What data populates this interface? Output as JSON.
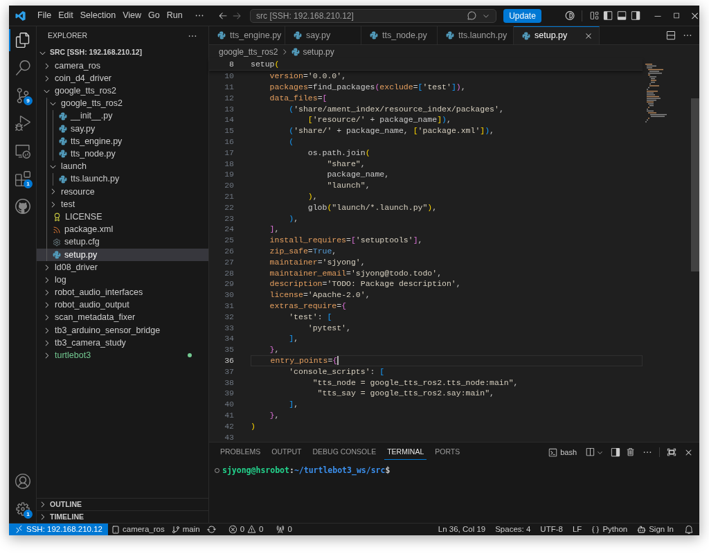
{
  "title_bar": {
    "menu": [
      "File",
      "Edit",
      "Selection",
      "View",
      "Go",
      "Run"
    ],
    "search": {
      "value": "src [SSH: 192.168.210.12]"
    },
    "update_button": "Update"
  },
  "activity_bar": {
    "top": [
      {
        "kind": "explorer",
        "selected": true
      },
      {
        "kind": "search",
        "selected": false
      },
      {
        "kind": "source_control",
        "selected": false,
        "badge": "9"
      },
      {
        "kind": "run",
        "selected": false
      },
      {
        "kind": "remote",
        "selected": false
      },
      {
        "kind": "extensions",
        "selected": false,
        "badge": "1"
      },
      {
        "kind": "github",
        "selected": false
      }
    ],
    "bottom": [
      {
        "kind": "accounts"
      },
      {
        "kind": "settings",
        "badge": "1"
      }
    ]
  },
  "sidebar": {
    "title": "EXPLORER",
    "root": "SRC [SSH: 192.168.210.12]",
    "items": [
      {
        "name": "camera_ros",
        "kind": "folder",
        "expanded": false,
        "selected": false,
        "modified": false
      },
      {
        "name": "coin_d4_driver",
        "kind": "folder",
        "expanded": false,
        "selected": false,
        "modified": false
      },
      {
        "name": "google_tts_ros2",
        "kind": "folder",
        "expanded": true,
        "selected": false,
        "modified": false,
        "children": [
          {
            "name": "google_tts_ros2",
            "kind": "folder",
            "expanded": true,
            "selected": false,
            "modified": false,
            "children": [
              {
                "name": "__init__.py",
                "kind": "python",
                "selected": false,
                "modified": false
              },
              {
                "name": "say.py",
                "kind": "python",
                "selected": false,
                "modified": false
              },
              {
                "name": "tts_engine.py",
                "kind": "python",
                "selected": false,
                "modified": false
              },
              {
                "name": "tts_node.py",
                "kind": "python",
                "selected": false,
                "modified": false
              }
            ]
          },
          {
            "name": "launch",
            "kind": "folder",
            "expanded": true,
            "selected": false,
            "modified": false,
            "children": [
              {
                "name": "tts.launch.py",
                "kind": "python",
                "selected": false,
                "modified": false
              }
            ]
          },
          {
            "name": "resource",
            "kind": "folder",
            "expanded": false,
            "selected": false,
            "modified": false
          },
          {
            "name": "test",
            "kind": "folder",
            "expanded": false,
            "selected": false,
            "modified": false
          },
          {
            "name": "LICENSE",
            "kind": "license",
            "selected": false,
            "modified": false
          },
          {
            "name": "package.xml",
            "kind": "xml",
            "selected": false,
            "modified": false
          },
          {
            "name": "setup.cfg",
            "kind": "config",
            "selected": false,
            "modified": false
          },
          {
            "name": "setup.py",
            "kind": "python",
            "selected": true,
            "modified": false
          }
        ]
      },
      {
        "name": "ld08_driver",
        "kind": "folder",
        "expanded": false,
        "selected": false,
        "modified": false
      },
      {
        "name": "log",
        "kind": "folder",
        "expanded": false,
        "selected": false,
        "modified": false
      },
      {
        "name": "robot_audio_interfaces",
        "kind": "folder",
        "expanded": false,
        "selected": false,
        "modified": false
      },
      {
        "name": "robot_audio_output",
        "kind": "folder",
        "expanded": false,
        "selected": false,
        "modified": false
      },
      {
        "name": "scan_metadata_fixer",
        "kind": "folder",
        "expanded": false,
        "selected": false,
        "modified": false
      },
      {
        "name": "tb3_arduino_sensor_bridge",
        "kind": "folder",
        "expanded": false,
        "selected": false,
        "modified": false
      },
      {
        "name": "tb3_camera_study",
        "kind": "folder",
        "expanded": false,
        "selected": false,
        "modified": false
      },
      {
        "name": "turtlebot3",
        "kind": "folder",
        "expanded": false,
        "selected": false,
        "modified": true
      }
    ],
    "sections": [
      {
        "label": "OUTLINE",
        "expanded": false
      },
      {
        "label": "TIMELINE",
        "expanded": false
      }
    ]
  },
  "tabs": [
    {
      "label": "tts_engine.py",
      "selected": false
    },
    {
      "label": "say.py",
      "selected": false
    },
    {
      "label": "tts_node.py",
      "selected": false
    },
    {
      "label": "tts.launch.py",
      "selected": false
    },
    {
      "label": "setup.py",
      "selected": true
    }
  ],
  "breadcrumb": [
    "google_tts_ros2",
    "setup.py"
  ],
  "sticky_line": {
    "number": "8",
    "tokens": [
      {
        "text": "setup",
        "kind": "plain"
      },
      {
        "text": "(",
        "kind": "gold"
      }
    ]
  },
  "code_lines": [
    {
      "number": "10",
      "current": false,
      "tokens": [
        {
          "text": "    version",
          "kind": "param"
        },
        {
          "text": "=",
          "kind": "plain"
        },
        {
          "text": "'0.0.0'",
          "kind": "string"
        },
        {
          "text": ",",
          "kind": "plain"
        }
      ]
    },
    {
      "number": "11",
      "current": false,
      "tokens": [
        {
          "text": "    packages",
          "kind": "param"
        },
        {
          "text": "=find_packages",
          "kind": "plain"
        },
        {
          "text": "(",
          "kind": "pink"
        },
        {
          "text": "exclude",
          "kind": "param"
        },
        {
          "text": "=",
          "kind": "plain"
        },
        {
          "text": "[",
          "kind": "blue"
        },
        {
          "text": "'test'",
          "kind": "string"
        },
        {
          "text": "]",
          "kind": "blue"
        },
        {
          "text": ")",
          "kind": "pink"
        },
        {
          "text": ",",
          "kind": "plain"
        }
      ]
    },
    {
      "number": "12",
      "current": false,
      "tokens": [
        {
          "text": "    data_files",
          "kind": "param"
        },
        {
          "text": "=",
          "kind": "plain"
        },
        {
          "text": "[",
          "kind": "pink"
        }
      ]
    },
    {
      "number": "13",
      "current": false,
      "tokens": [
        {
          "text": "        (",
          "kind": "blue"
        },
        {
          "text": "'share/ament_index/resource_index/packages'",
          "kind": "string"
        },
        {
          "text": ",",
          "kind": "plain"
        }
      ]
    },
    {
      "number": "14",
      "current": false,
      "tokens": [
        {
          "text": "            [",
          "kind": "gold"
        },
        {
          "text": "'resource/'",
          "kind": "string"
        },
        {
          "text": " + package_name",
          "kind": "plain"
        },
        {
          "text": "]",
          "kind": "gold"
        },
        {
          "text": ")",
          "kind": "blue"
        },
        {
          "text": ",",
          "kind": "plain"
        }
      ]
    },
    {
      "number": "15",
      "current": false,
      "tokens": [
        {
          "text": "        (",
          "kind": "blue"
        },
        {
          "text": "'share/'",
          "kind": "string"
        },
        {
          "text": " + package_name, ",
          "kind": "plain"
        },
        {
          "text": "[",
          "kind": "gold"
        },
        {
          "text": "'package.xml'",
          "kind": "string"
        },
        {
          "text": "]",
          "kind": "gold"
        },
        {
          "text": ")",
          "kind": "blue"
        },
        {
          "text": ",",
          "kind": "plain"
        }
      ]
    },
    {
      "number": "16",
      "current": false,
      "tokens": [
        {
          "text": "        (",
          "kind": "blue"
        }
      ]
    },
    {
      "number": "17",
      "current": false,
      "tokens": [
        {
          "text": "            os.path.join",
          "kind": "plain"
        },
        {
          "text": "(",
          "kind": "gold"
        }
      ]
    },
    {
      "number": "18",
      "current": false,
      "tokens": [
        {
          "text": "                \"share\"",
          "kind": "string"
        },
        {
          "text": ",",
          "kind": "plain"
        }
      ]
    },
    {
      "number": "19",
      "current": false,
      "tokens": [
        {
          "text": "                package_name,",
          "kind": "plain"
        }
      ]
    },
    {
      "number": "20",
      "current": false,
      "tokens": [
        {
          "text": "                \"launch\"",
          "kind": "string"
        },
        {
          "text": ",",
          "kind": "plain"
        }
      ]
    },
    {
      "number": "21",
      "current": false,
      "tokens": [
        {
          "text": "            )",
          "kind": "gold"
        },
        {
          "text": ",",
          "kind": "plain"
        }
      ]
    },
    {
      "number": "22",
      "current": false,
      "tokens": [
        {
          "text": "            glob",
          "kind": "plain"
        },
        {
          "text": "(",
          "kind": "gold"
        },
        {
          "text": "\"launch/*.launch.py\"",
          "kind": "string"
        },
        {
          "text": ")",
          "kind": "gold"
        },
        {
          "text": ",",
          "kind": "plain"
        }
      ]
    },
    {
      "number": "23",
      "current": false,
      "tokens": [
        {
          "text": "        )",
          "kind": "blue"
        },
        {
          "text": ",",
          "kind": "plain"
        }
      ]
    },
    {
      "number": "24",
      "current": false,
      "tokens": [
        {
          "text": "    ]",
          "kind": "pink"
        },
        {
          "text": ",",
          "kind": "plain"
        }
      ]
    },
    {
      "number": "25",
      "current": false,
      "tokens": [
        {
          "text": "    install_requires",
          "kind": "param"
        },
        {
          "text": "=",
          "kind": "plain"
        },
        {
          "text": "[",
          "kind": "pink"
        },
        {
          "text": "'setuptools'",
          "kind": "string"
        },
        {
          "text": "]",
          "kind": "pink"
        },
        {
          "text": ",",
          "kind": "plain"
        }
      ]
    },
    {
      "number": "26",
      "current": false,
      "tokens": [
        {
          "text": "    zip_safe",
          "kind": "param"
        },
        {
          "text": "=",
          "kind": "plain"
        },
        {
          "text": "True",
          "kind": "const"
        },
        {
          "text": ",",
          "kind": "plain"
        }
      ]
    },
    {
      "number": "27",
      "current": false,
      "tokens": [
        {
          "text": "    maintainer",
          "kind": "param"
        },
        {
          "text": "=",
          "kind": "plain"
        },
        {
          "text": "'sjyong'",
          "kind": "string"
        },
        {
          "text": ",",
          "kind": "plain"
        }
      ]
    },
    {
      "number": "28",
      "current": false,
      "tokens": [
        {
          "text": "    maintainer_email",
          "kind": "param"
        },
        {
          "text": "=",
          "kind": "plain"
        },
        {
          "text": "'sjyong@todo.todo'",
          "kind": "string"
        },
        {
          "text": ",",
          "kind": "plain"
        }
      ]
    },
    {
      "number": "29",
      "current": false,
      "tokens": [
        {
          "text": "    description",
          "kind": "param"
        },
        {
          "text": "=",
          "kind": "plain"
        },
        {
          "text": "'TODO: Package description'",
          "kind": "string"
        },
        {
          "text": ",",
          "kind": "plain"
        }
      ]
    },
    {
      "number": "30",
      "current": false,
      "tokens": [
        {
          "text": "    license",
          "kind": "param"
        },
        {
          "text": "=",
          "kind": "plain"
        },
        {
          "text": "'Apache-2.0'",
          "kind": "string"
        },
        {
          "text": ",",
          "kind": "plain"
        }
      ]
    },
    {
      "number": "31",
      "current": false,
      "tokens": [
        {
          "text": "    extras_require",
          "kind": "param"
        },
        {
          "text": "=",
          "kind": "plain"
        },
        {
          "text": "{",
          "kind": "pink"
        }
      ]
    },
    {
      "number": "32",
      "current": false,
      "tokens": [
        {
          "text": "        'test'",
          "kind": "string"
        },
        {
          "text": ": ",
          "kind": "plain"
        },
        {
          "text": "[",
          "kind": "blue"
        }
      ]
    },
    {
      "number": "33",
      "current": false,
      "tokens": [
        {
          "text": "            'pytest'",
          "kind": "string"
        },
        {
          "text": ",",
          "kind": "plain"
        }
      ]
    },
    {
      "number": "34",
      "current": false,
      "tokens": [
        {
          "text": "        ]",
          "kind": "blue"
        },
        {
          "text": ",",
          "kind": "plain"
        }
      ]
    },
    {
      "number": "35",
      "current": false,
      "tokens": [
        {
          "text": "    }",
          "kind": "pink"
        },
        {
          "text": ",",
          "kind": "plain"
        }
      ]
    },
    {
      "number": "36",
      "current": true,
      "tokens": [
        {
          "text": "    entry_points",
          "kind": "param"
        },
        {
          "text": "=",
          "kind": "plain"
        },
        {
          "text": "{",
          "kind": "pink"
        }
      ]
    },
    {
      "number": "37",
      "current": false,
      "tokens": [
        {
          "text": "        'console_scripts'",
          "kind": "string"
        },
        {
          "text": ": ",
          "kind": "plain"
        },
        {
          "text": "[",
          "kind": "blue"
        }
      ]
    },
    {
      "number": "38",
      "current": false,
      "tokens": [
        {
          "text": "             \"tts_node = google_tts_ros2.tts_node:main\"",
          "kind": "string"
        },
        {
          "text": ",",
          "kind": "plain"
        }
      ]
    },
    {
      "number": "39",
      "current": false,
      "tokens": [
        {
          "text": "              \"tts_say = google_tts_ros2.say:main\"",
          "kind": "string"
        },
        {
          "text": ",",
          "kind": "plain"
        }
      ]
    },
    {
      "number": "40",
      "current": false,
      "tokens": [
        {
          "text": "        ]",
          "kind": "blue"
        },
        {
          "text": ",",
          "kind": "plain"
        }
      ]
    },
    {
      "number": "41",
      "current": false,
      "tokens": [
        {
          "text": "    }",
          "kind": "pink"
        },
        {
          "text": ",",
          "kind": "plain"
        }
      ]
    },
    {
      "number": "42",
      "current": false,
      "tokens": [
        {
          "text": ")",
          "kind": "gold"
        }
      ]
    },
    {
      "number": "43",
      "current": false
    }
  ],
  "panel": {
    "tabs": [
      {
        "label": "PROBLEMS",
        "selected": false
      },
      {
        "label": "OUTPUT",
        "selected": false
      },
      {
        "label": "DEBUG CONSOLE",
        "selected": false
      },
      {
        "label": "TERMINAL",
        "selected": true
      },
      {
        "label": "PORTS",
        "selected": false
      }
    ],
    "terminal_name": "bash",
    "prompt": {
      "user": "sjyong@hsrobot",
      "separator": ":",
      "path": "~/turtlebot3_ws/src",
      "symbol": "$"
    }
  },
  "status_bar": {
    "left": [
      {
        "kind": "remote",
        "text": "SSH: 192.168.210.12"
      },
      {
        "kind": "folder",
        "text": "camera_ros"
      },
      {
        "kind": "branch",
        "text": "main"
      },
      {
        "kind": "sync"
      },
      {
        "kind": "problems",
        "errors": "0",
        "warnings": "0"
      },
      {
        "kind": "ports",
        "text": "0"
      }
    ],
    "right": [
      {
        "kind": "text",
        "text": "Ln 36, Col 19"
      },
      {
        "kind": "text",
        "text": "Spaces: 4"
      },
      {
        "kind": "text",
        "text": "UTF-8"
      },
      {
        "kind": "text",
        "text": "LF"
      },
      {
        "kind": "language",
        "text": "Python"
      },
      {
        "kind": "account",
        "text": "Sign In"
      },
      {
        "kind": "bell"
      }
    ]
  }
}
